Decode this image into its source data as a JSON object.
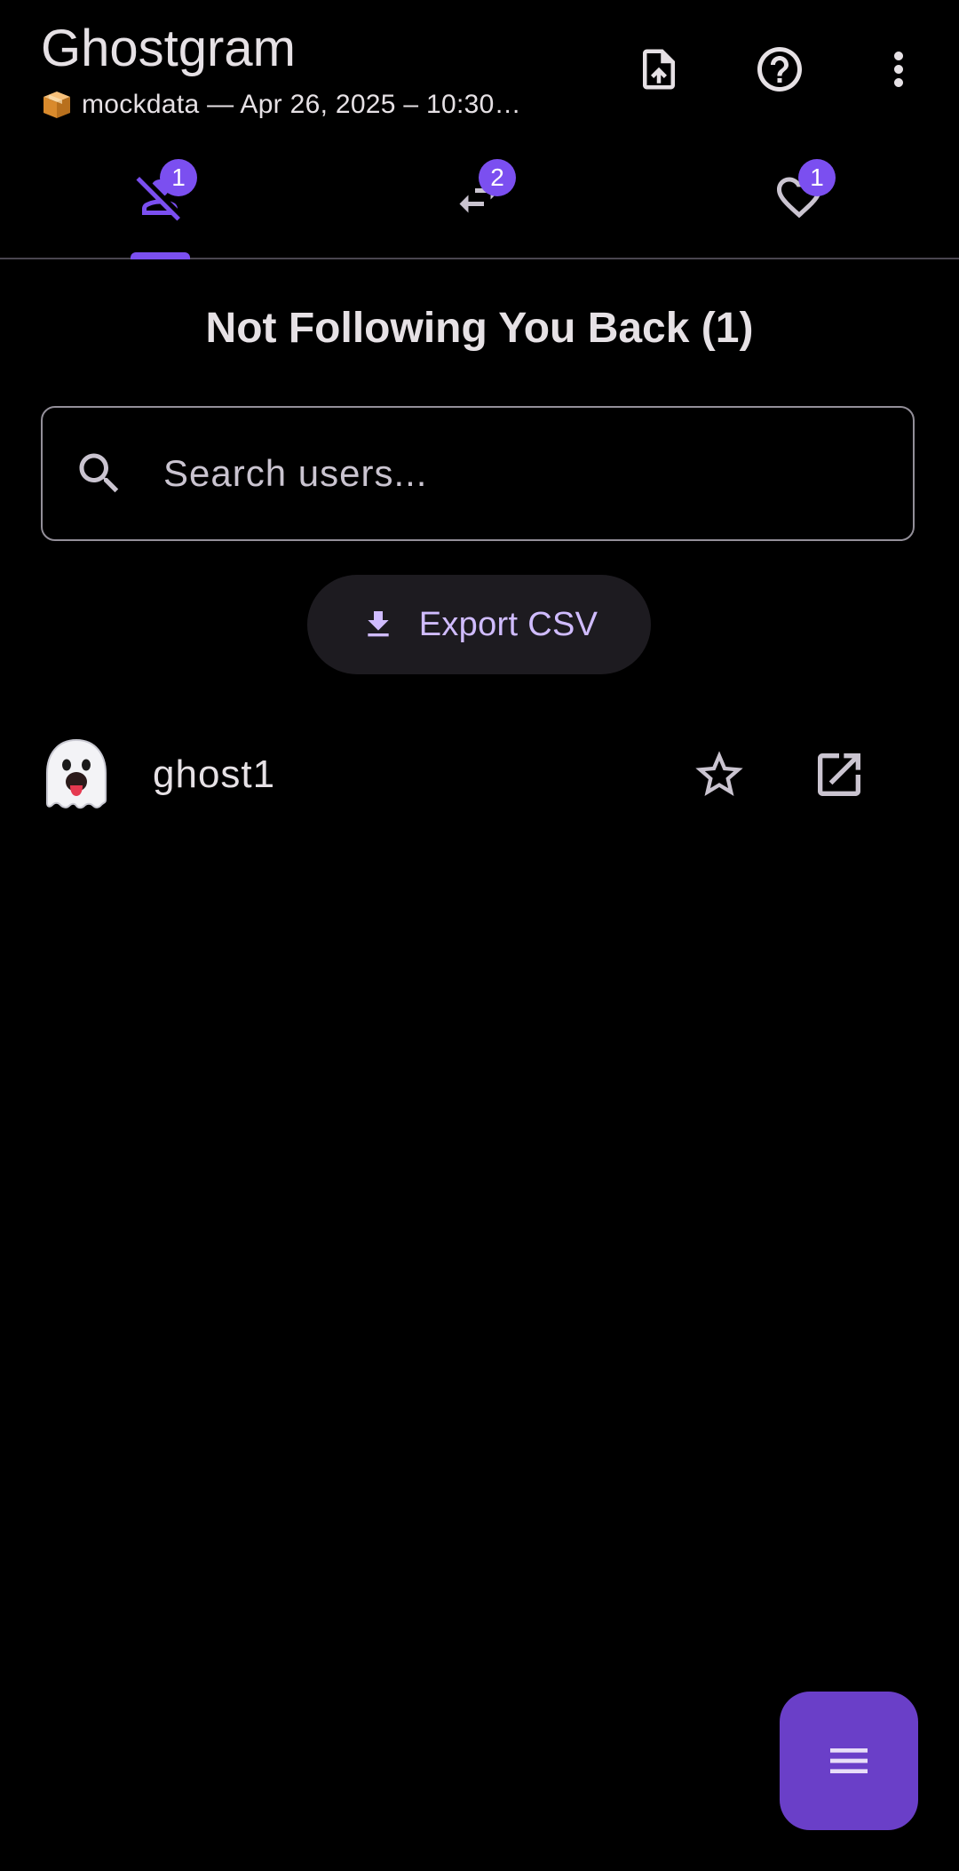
{
  "app": {
    "title": "Ghostgram",
    "subtitle": "mockdata — Apr 26, 2025 – 10:30…",
    "subtitle_icon": "package-icon"
  },
  "toolbar": {
    "actions": [
      {
        "icon": "file-upload-icon"
      },
      {
        "icon": "help-circle-icon"
      },
      {
        "icon": "more-vert-icon"
      }
    ]
  },
  "tabs": [
    {
      "icon": "person-off-icon",
      "badge": "1",
      "selected": true
    },
    {
      "icon": "swap-horiz-icon",
      "badge": "2",
      "selected": false
    },
    {
      "icon": "heart-outline-icon",
      "badge": "1",
      "selected": false
    }
  ],
  "section": {
    "title": "Not Following You Back (1)"
  },
  "search": {
    "placeholder": "Search users...",
    "value": ""
  },
  "export": {
    "label": "Export CSV",
    "icon": "download-icon"
  },
  "users": [
    {
      "name": "ghost1",
      "avatar": "ghost-emoji",
      "favorite_icon": "star-outline-icon",
      "open_icon": "open-in-new-icon"
    }
  ],
  "fab": {
    "icon": "menu-icon"
  },
  "colors": {
    "background": "#000000",
    "accent": "#7b4ff0",
    "fab": "#6a3fc8",
    "on_surface": "#e6e1e5",
    "export_text": "#d0bcff",
    "outline": "#938f99"
  }
}
